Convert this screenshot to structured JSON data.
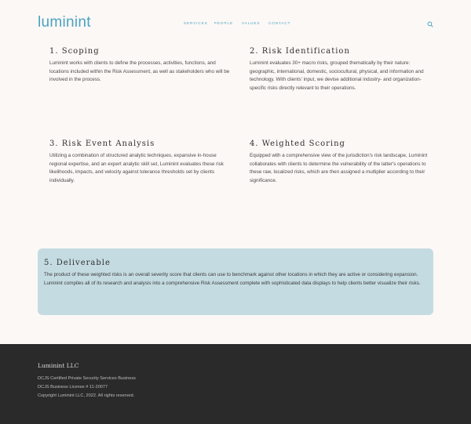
{
  "header": {
    "logo": "luminint",
    "nav": [
      "SERVICES",
      "PEOPLE",
      "VALUES",
      "CONTACT"
    ],
    "search_icon": "search-icon"
  },
  "sections": [
    {
      "title": "1. Scoping",
      "body": "Luminint works with clients to define the processes, activities, functions, and locations included within the Risk Assessment, as well as stakeholders who will be involved in the process."
    },
    {
      "title": "2. Risk Identification",
      "body": "Luminint evaluates 30+ macro risks, grouped thematically by their nature: geographic, international, domestic, sociocultural, physical, and information and technology. With clients' input, we devise additional industry- and organization-specific risks directly relevant to their operations."
    },
    {
      "title": "3. Risk Event Analysis",
      "body": "Utilizing a combination of structured analytic techniques, expansive in-house regional expertise, and an expert analytic skill set, Luminint evaluates these risk likelihoods, impacts, and velocity against tolerance thresholds set by clients individually."
    },
    {
      "title": "4. Weighted Scoring",
      "body": "Equipped with a comprehensive view of the jurisdiction's risk landscape, Luminint collaborates with clients to determine the vulnerability of the latter's operations to these raw, localized risks, which are then assigned a multiplier according to their significance."
    }
  ],
  "deliverable": {
    "title": "5. Deliverable",
    "body": "The product of these weighted risks is an overall severity score that clients can use to benchmark against other locations in which they are active or considering expansion. Luminint compiles all of its research and analysis into a comprehensive Risk Assessment complete with sophisticated data displays to help clients better visualize their risks."
  },
  "footer": {
    "name": "Luminint LLC",
    "lines": [
      "DCJS Certified Private Security Services Business",
      "DCJS Business License # 11-20077",
      "Copyright Luminint LLC, 2022.  All rights reserved."
    ]
  },
  "colors": {
    "accent": "#4aa3c0",
    "background": "#fcf8f6",
    "deliverable_bg": "#c5dbe2",
    "footer_bg": "#2a2a2a"
  }
}
